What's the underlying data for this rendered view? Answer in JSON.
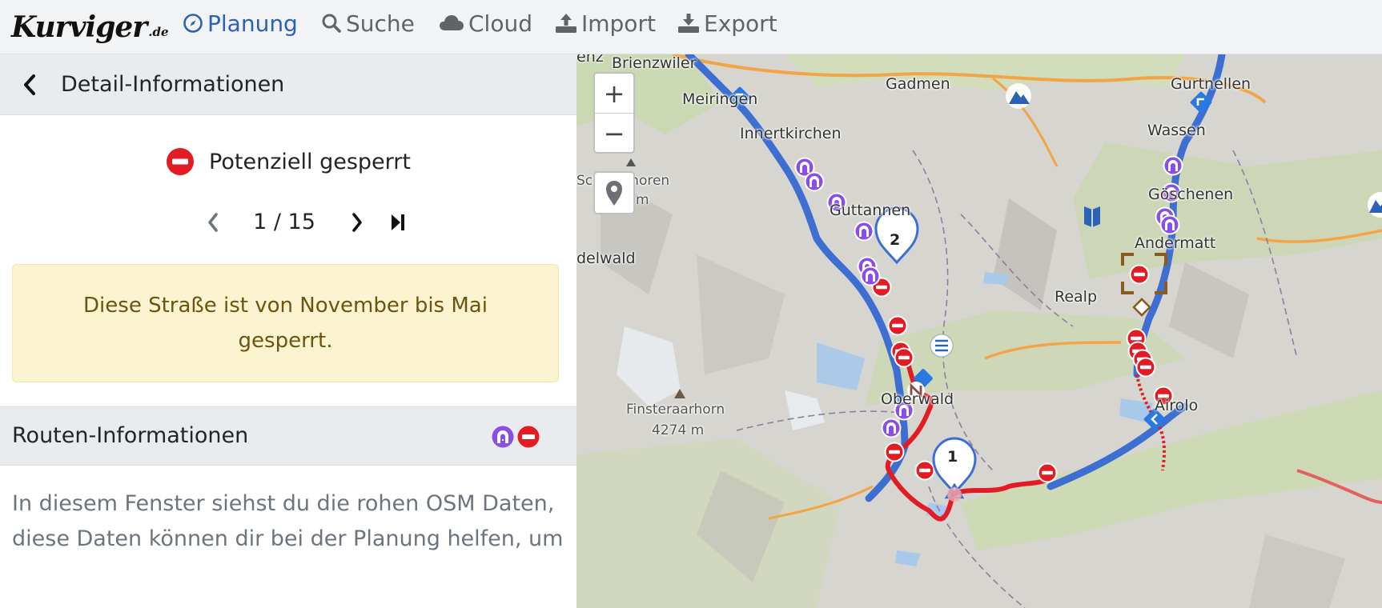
{
  "logo": {
    "main": "Kurviger",
    "tld": ".de"
  },
  "nav": [
    {
      "label": "Planung",
      "icon": "compass-icon",
      "active": true
    },
    {
      "label": "Suche",
      "icon": "search-icon"
    },
    {
      "label": "Cloud",
      "icon": "cloud-icon"
    },
    {
      "label": "Import",
      "icon": "upload-icon"
    },
    {
      "label": "Export",
      "icon": "download-icon"
    }
  ],
  "detail": {
    "title": "Detail-Informationen",
    "status": "Potenziell gesperrt",
    "pager": {
      "text": "1 / 15"
    },
    "alert": "Diese Straße ist von November bis Mai gesperrt."
  },
  "route": {
    "title": "Routen-Informationen",
    "text": "In diesem Fenster siehst du die rohen OSM Daten, diese Daten können dir bei der Planung helfen, um"
  },
  "map": {
    "controls": {
      "zoom_in": "+",
      "zoom_out": "−"
    },
    "places": [
      {
        "name": "Brienzwiler"
      },
      {
        "name": "Gadmen"
      },
      {
        "name": "Gurtnellen"
      },
      {
        "name": "Meiringen"
      },
      {
        "name": "Innertkirchen"
      },
      {
        "name": "Wassen"
      },
      {
        "name": "Schreckhoren"
      },
      {
        "name": "Göschenen"
      },
      {
        "name": "Guttannen"
      },
      {
        "name": "Andermatt"
      },
      {
        "name": "delwald"
      },
      {
        "name": "Realp"
      },
      {
        "name": "Oberwald"
      },
      {
        "name": "Finsteraarhorn"
      },
      {
        "name": "4274 m"
      },
      {
        "name": "Airolo"
      },
      {
        "name": "enz"
      },
      {
        "name": "m"
      }
    ],
    "waypoints": [
      "1",
      "2"
    ]
  },
  "colors": {
    "accent": "#2b62b8",
    "route": "#3d6fd3",
    "blocked": "#e31b23",
    "tunnel": "#8a4ee6",
    "alert_bg": "#fcf4d1"
  }
}
